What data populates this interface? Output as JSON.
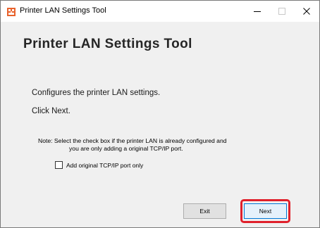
{
  "window": {
    "title": "Printer LAN Settings Tool"
  },
  "content": {
    "heading": "Printer LAN Settings Tool",
    "description": "Configures the printer LAN settings.",
    "instruction": "Click Next.",
    "note_line1": "Note: Select the check box if the printer LAN is already configured and",
    "note_line2": "you are only adding a original TCP/IP port.",
    "checkbox_label": "Add original TCP/IP port only",
    "checkbox_checked": false
  },
  "buttons": {
    "exit": "Exit",
    "next": "Next"
  },
  "colors": {
    "highlight": "#e0202b",
    "focus_border": "#0078d7"
  },
  "icons": {
    "app": "printer-app-icon",
    "minimize": "minimize-icon",
    "maximize": "maximize-icon",
    "close": "close-icon"
  }
}
